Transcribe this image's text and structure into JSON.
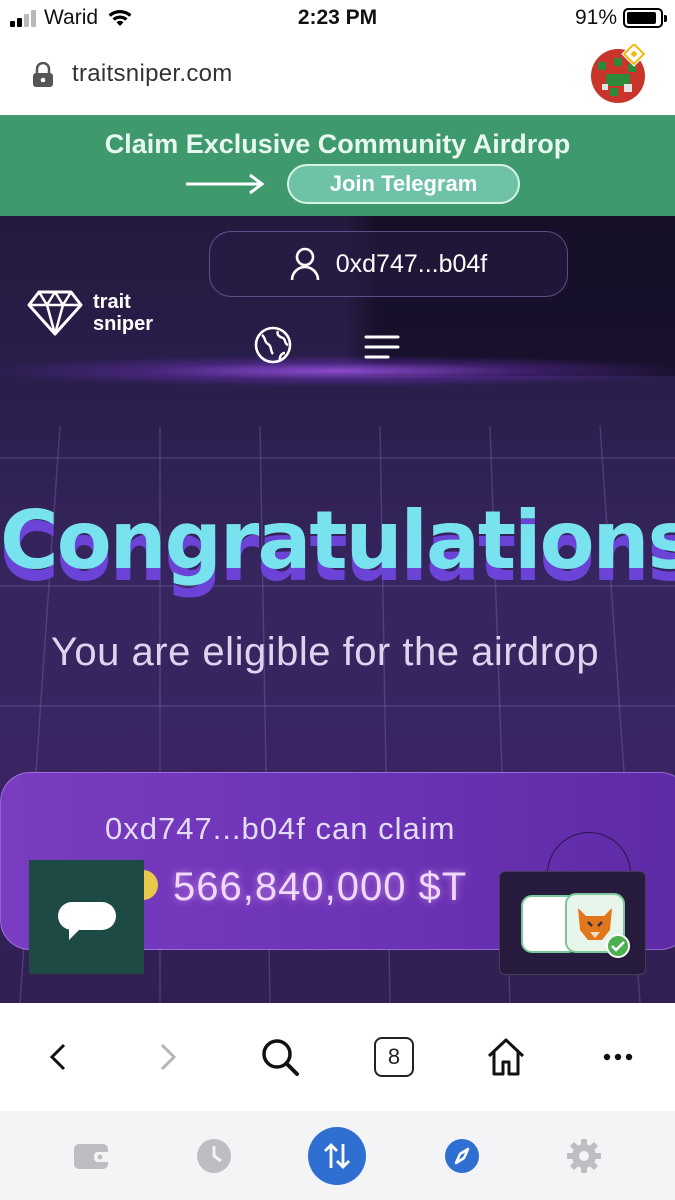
{
  "status_bar": {
    "carrier": "Warid",
    "time": "2:23 PM",
    "battery": "91%",
    "battery_level": 0.91
  },
  "browser": {
    "url": "traitsniper.com",
    "open_tabs": "8"
  },
  "banner": {
    "title": "Claim Exclusive Community Airdrop",
    "button_label": "Join Telegram"
  },
  "header": {
    "wallet_address": "0xd747...b04f",
    "logo_line1": "trait",
    "logo_line2": "sniper"
  },
  "hero": {
    "title": "Congratulations",
    "subtitle": "You are eligible for the airdrop"
  },
  "claim": {
    "address_line": "0xd747...b04f can claim",
    "amount": "566,840,000 $T"
  },
  "colors": {
    "banner_green": "#3e9a6c",
    "title_cyan": "#78e2ee",
    "title_shadow_purple": "#6b43d6",
    "card_purple": "#7a3cc0",
    "swap_blue": "#2e6fd1",
    "chat_green": "#1d4a45"
  },
  "icons": {
    "toolbar": [
      "back-icon",
      "forward-icon",
      "search-icon",
      "tabs-icon",
      "home-icon",
      "more-icon"
    ],
    "bottom_nav": [
      "wallet-icon",
      "history-icon",
      "swap-icon",
      "browser-icon",
      "settings-icon"
    ]
  }
}
